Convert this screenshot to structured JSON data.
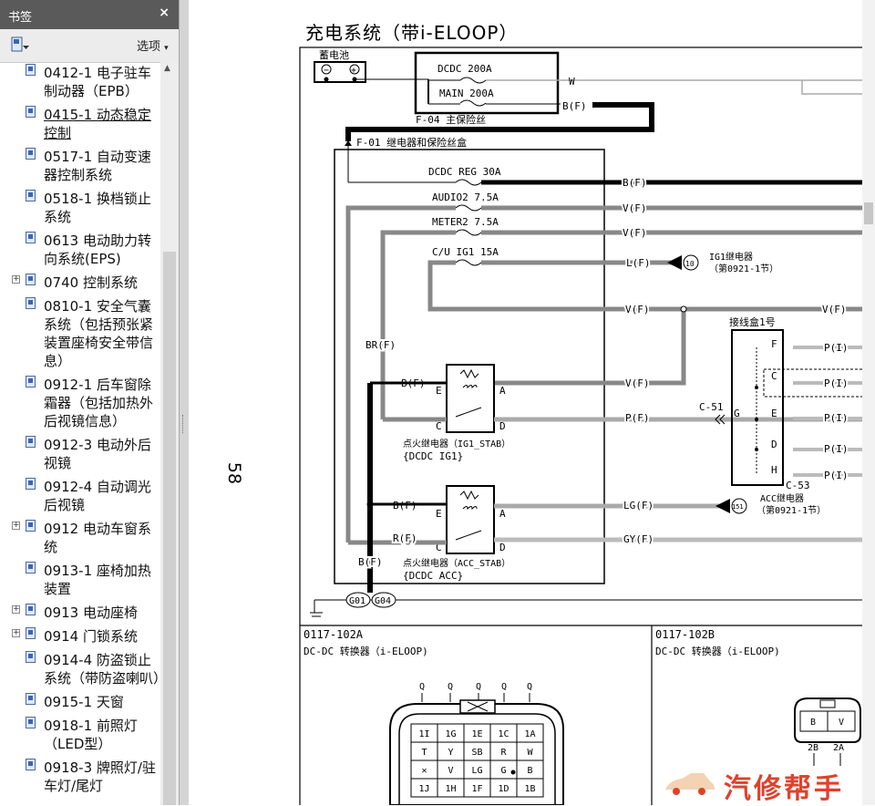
{
  "sidebar": {
    "title": "书签",
    "close": "×",
    "options": "选项",
    "items": [
      {
        "label": "0412-1 电子驻车制动器（EPB）",
        "expandable": false,
        "active": false
      },
      {
        "label": "0415-1 动态稳定控制",
        "expandable": false,
        "active": true
      },
      {
        "label": "0517-1 自动变速器控制系统",
        "expandable": false,
        "active": false
      },
      {
        "label": "0518-1 换档锁止系统",
        "expandable": false,
        "active": false
      },
      {
        "label": "0613 电动助力转向系统(EPS)",
        "expandable": false,
        "active": false
      },
      {
        "label": "0740 控制系统",
        "expandable": true,
        "active": false
      },
      {
        "label": "0810-1 安全气囊系统（包括预张紧装置座椅安全带信息）",
        "expandable": false,
        "active": false
      },
      {
        "label": "0912-1 后车窗除霜器（包括加热外后视镜信息）",
        "expandable": false,
        "active": false
      },
      {
        "label": "0912-3 电动外后视镜",
        "expandable": false,
        "active": false
      },
      {
        "label": "0912-4 自动调光后视镜",
        "expandable": false,
        "active": false
      },
      {
        "label": "0912 电动车窗系统",
        "expandable": true,
        "active": false
      },
      {
        "label": "0913-1 座椅加热装置",
        "expandable": false,
        "active": false
      },
      {
        "label": "0913  电动座椅",
        "expandable": true,
        "active": false
      },
      {
        "label": "0914 门锁系统",
        "expandable": true,
        "active": false
      },
      {
        "label": "0914-4 防盗锁止系统（带防盗喇叭）",
        "expandable": false,
        "active": false
      },
      {
        "label": "0915-1 天窗",
        "expandable": false,
        "active": false
      },
      {
        "label": "0918-1 前照灯（LED型）",
        "expandable": false,
        "active": false
      },
      {
        "label": "0918-3 牌照灯/驻车灯/尾灯",
        "expandable": false,
        "active": false
      }
    ]
  },
  "document": {
    "page_number": "58",
    "title": "充电系统（带i-ELOOP）",
    "labels": {
      "battery": "蓄电池",
      "minus": "−",
      "plus": "+",
      "dcdc200": "DCDC 200A",
      "main200": "MAIN 200A",
      "f04": "F-04 主保险丝",
      "f01": "F-01 继电器和保险丝盒",
      "dcdc_reg": "DCDC REG 30A",
      "audio2": "AUDIO2 7.5A",
      "meter2": "METER2 7.5A",
      "cu_ig1": "C/U IG1 15A",
      "w": "W",
      "bf": "B(F)",
      "vf": "V(F)",
      "lf": "L(F)",
      "pf": "P(F)",
      "lgf": "LG(F)",
      "gyf": "GY(F)",
      "brf": "BR(F)",
      "rf": "R(F)",
      "pi": "P(I)",
      "ig1_relay": "IG1继电器",
      "ig1_relay_ref": "（第0921-1节）",
      "ref10": "10",
      "ref151": "151",
      "junction_box": "接线盒1号",
      "c51": "C-51",
      "c53": "C-53",
      "acc_relay": "ACC继电器",
      "acc_relay_ref": "（第0921-1节）",
      "relay1_name": "点火继电器（IG1_STAB）",
      "relay1_sub": "{DCDC IG1}",
      "relay2_name": "点火继电器（ACC_STAB）",
      "relay2_sub": "{DCDC ACC}",
      "pin_e": "E",
      "pin_a": "A",
      "pin_c": "C",
      "pin_d": "D",
      "pin_f": "F",
      "pin_g": "G",
      "pin_h": "H",
      "g01": "G01",
      "g04": "G04",
      "conn_a_code": "0117-102A",
      "conn_a_name": "DC-DC 转换器（i-ELOOP)",
      "conn_b_code": "0117-102B",
      "conn_b_name": "DC-DC 转换器（i-ELOOP)",
      "q": "Q",
      "conn_b_b": "B",
      "conn_b_v": "V",
      "conn_b_2b": "2B",
      "conn_b_2a": "2A"
    },
    "connector_a_grid": [
      [
        "1I",
        "1G",
        "1E",
        "1C",
        "1A"
      ],
      [
        "T",
        "Y",
        "SB",
        "R",
        "W"
      ],
      [
        "✕",
        "V",
        "LG",
        "G",
        "B"
      ],
      [
        "1J",
        "1H",
        "1F",
        "1D",
        "1B"
      ]
    ],
    "watermark": "汽修帮手"
  }
}
